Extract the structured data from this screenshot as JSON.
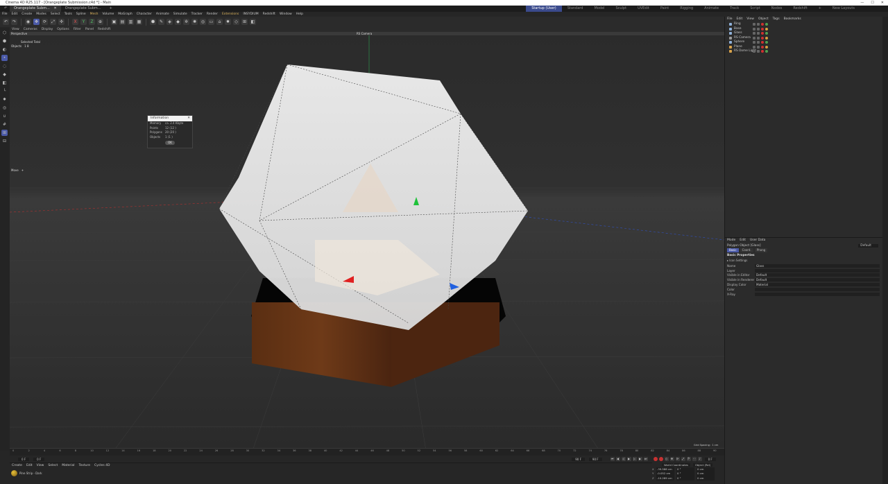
{
  "window": {
    "title": "Cinema 4D R25.117 - [Orangeplate Submission.c4d *] - Main",
    "controls": [
      "—",
      "☐",
      "✕"
    ]
  },
  "tabs": {
    "doc_tab": "Orangeplate Subm...",
    "doc_tab_close": "✕",
    "second_tab": "Orangeplate Subm...",
    "add_tab": "+",
    "layouts": [
      "Startup (User)",
      "Standard",
      "Model",
      "Sculpt",
      "UVEdit",
      "Paint",
      "Rigging",
      "Animate",
      "Track",
      "Script",
      "Nodes",
      "Redshift"
    ],
    "add_layout": "+",
    "new_layouts": "New Layouts"
  },
  "menubar": {
    "items": [
      "File",
      "Edit",
      "Create",
      "Modes",
      "Select",
      "Tools",
      "Spline",
      "Mesh",
      "Volume",
      "MoGraph",
      "Character",
      "Animate",
      "Simulate",
      "Tracker",
      "Render",
      "Extensions",
      "INSYDIUM",
      "Redshift",
      "Window",
      "Help"
    ],
    "highlight": [
      "Mesh",
      "Extensions"
    ]
  },
  "toolbar": {
    "icons": [
      "undo-icon",
      "redo-icon",
      "live-select-icon",
      "move-icon",
      "rotate-icon",
      "scale-icon",
      "transform-icon",
      "x-axis-icon",
      "y-axis-icon",
      "z-axis-icon",
      "coordinate-system-icon",
      "render-view-icon",
      "render-picture-viewer-icon",
      "edit-render-settings-icon",
      "render-queue-icon",
      "cube-icon",
      "pen-icon",
      "subdivision-icon",
      "extrude-icon",
      "cloner-icon",
      "field-icon",
      "deformer-icon",
      "floor-icon",
      "camera-icon",
      "light-icon",
      "tag-icon",
      "grid-icon",
      "layer-icon"
    ],
    "glyphs": [
      "↶",
      "↷",
      "◉",
      "✥",
      "⟳",
      "⤢",
      "✣",
      "X",
      "Y",
      "Z",
      "⊕",
      "▣",
      "▤",
      "▥",
      "▦",
      "⬢",
      "✎",
      "◈",
      "◆",
      "✲",
      "✺",
      "◎",
      "▭",
      "⌂",
      "✹",
      "◇",
      "⊞",
      "◧"
    ]
  },
  "viewport": {
    "menu": [
      "View",
      "Cameras",
      "Display",
      "Options",
      "Filter",
      "Panel",
      "Redshift"
    ],
    "label": "Perspective",
    "camera": "RS Camera",
    "selected_total": "Selected Total",
    "stats_label": "Objects",
    "stats_values": "1       8",
    "scene_label": "Move",
    "scene_label_suffix": "+",
    "grid_spacing": "Grid Spacing : 1 cm"
  },
  "info_dialog": {
    "title": "Information",
    "close": "✕",
    "rows": [
      {
        "k": "Memory",
        "v": "ca. 2.4 Kbyte"
      },
      {
        "k": "Points",
        "v": "12 (12 )"
      },
      {
        "k": "Polygons",
        "v": "20 (20 )"
      },
      {
        "k": "Objects",
        "v": "1 (1 )"
      }
    ],
    "ok": "OK"
  },
  "object_manager": {
    "menu": [
      "File",
      "Edit",
      "View",
      "Object",
      "Tags",
      "Bookmarks"
    ],
    "objects": [
      {
        "name": "Ring",
        "color": "#8fb0d8"
      },
      {
        "name": "Base",
        "color": "#8fb0d8"
      },
      {
        "name": "Glass",
        "color": "#8fb0d8"
      },
      {
        "name": "RS Camera",
        "color": "#9a9a9a"
      },
      {
        "name": "Sphere",
        "color": "#8fb0d8"
      },
      {
        "name": "Plane",
        "color": "#d8a24a"
      },
      {
        "name": "RS Dome Light",
        "color": "#d8a24a"
      }
    ]
  },
  "attribute_manager": {
    "menu": [
      "Mode",
      "Edit",
      "User Data"
    ],
    "object_title": "Polygon Object [Glass]",
    "preset": "Default",
    "tabs": [
      "Basic",
      "Coord.",
      "Phong"
    ],
    "section": "Basic Properties",
    "subsection": "▸ Icon Settings",
    "props": [
      {
        "label": "Name",
        "value": "Glass"
      },
      {
        "label": "Layer",
        "value": ""
      },
      {
        "label": "Visible in Editor",
        "value": "Default"
      },
      {
        "label": "Visible in Renderer",
        "value": "Default"
      },
      {
        "label": "Display Color",
        "value": "Material"
      },
      {
        "label": "Color",
        "value": ""
      },
      {
        "label": "X-Ray",
        "value": ""
      }
    ]
  },
  "timeline": {
    "frames": [
      "0",
      "2",
      "4",
      "6",
      "8",
      "10",
      "12",
      "14",
      "16",
      "18",
      "20",
      "22",
      "24",
      "26",
      "28",
      "30",
      "32",
      "34",
      "36",
      "38",
      "40",
      "42",
      "44",
      "46",
      "48",
      "50",
      "52",
      "54",
      "56",
      "58",
      "60",
      "62",
      "64",
      "66",
      "68",
      "70",
      "72",
      "74",
      "76",
      "78",
      "80",
      "82",
      "84",
      "86",
      "88",
      "90"
    ],
    "current_frame": "0 F",
    "start": "0 F",
    "end_a": "90 F",
    "end_b": "90 F",
    "end_field": "0 F"
  },
  "material_manager": {
    "menu": [
      "Create",
      "Edit",
      "View",
      "Select",
      "Material",
      "Texture",
      "Cycles 4D"
    ],
    "material": "Pine Strip - Dark"
  },
  "coordinates": {
    "mode_a": "World Coordinates",
    "mode_b": "Object (Rel)",
    "rows": [
      {
        "axis": "X",
        "pos": "-39.588 cm",
        "rot": "0 °",
        "scale": "0 cm"
      },
      {
        "axis": "Y",
        "pos": "-0.052 cm",
        "rot": "0 °",
        "scale": "0 cm"
      },
      {
        "axis": "Z",
        "pos": "-10.289 cm",
        "rot": "0 °",
        "scale": "0 cm"
      }
    ]
  }
}
